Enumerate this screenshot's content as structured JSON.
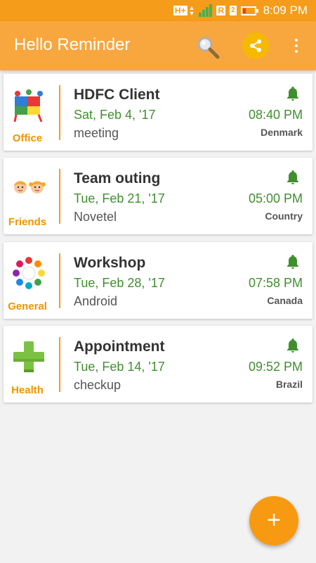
{
  "status_bar": {
    "network_label": "H+",
    "roaming_label": "R",
    "sim_label": "2",
    "time": "8:09 PM"
  },
  "app_bar": {
    "title": "Hello Reminder",
    "icons": [
      "search-icon",
      "share-icon",
      "more-vert-icon"
    ]
  },
  "colors": {
    "primary": "#f7a73d",
    "status_bar": "#f59c1a",
    "accent": "#f79a11",
    "date_time_green": "#3f8f2e",
    "category_orange": "#f29400"
  },
  "reminders": [
    {
      "category": "Office",
      "category_icon": "office-puzzle-people-icon",
      "title": "HDFC Client",
      "date": "Sat, Feb 4, '17",
      "note": "meeting",
      "time": "08:40 PM",
      "country": "Denmark"
    },
    {
      "category": "Friends",
      "category_icon": "friends-kids-icon",
      "title": "Team outing",
      "date": "Tue, Feb 21, '17",
      "note": "Novetel",
      "time": "05:00 PM",
      "country": "Country"
    },
    {
      "category": "General",
      "category_icon": "general-circle-people-icon",
      "title": "Workshop",
      "date": "Tue, Feb 28, '17",
      "note": "Android",
      "time": "07:58 PM",
      "country": "Canada"
    },
    {
      "category": "Health",
      "category_icon": "health-cross-icon",
      "title": "Appointment",
      "date": "Tue, Feb 14, '17",
      "note": "checkup",
      "time": "09:52 PM",
      "country": "Brazil"
    }
  ],
  "fab": {
    "label": "+",
    "icon": "add-icon"
  }
}
